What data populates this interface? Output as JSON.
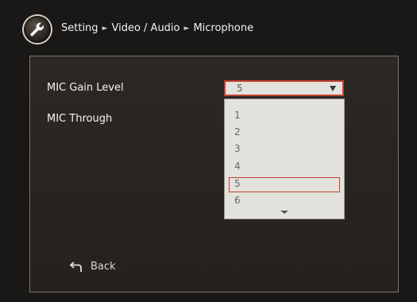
{
  "header": {
    "breadcrumb": [
      "Setting",
      "Video / Audio",
      "Microphone"
    ],
    "separator": "►"
  },
  "settings": {
    "mic_gain": {
      "label": "MIC Gain Level",
      "selected": "5",
      "options": [
        "1",
        "2",
        "3",
        "4",
        "5",
        "6"
      ]
    },
    "mic_through": {
      "label": "MIC Through"
    }
  },
  "footer": {
    "back_label": "Back"
  },
  "colors": {
    "accent": "#c2422f",
    "panel": "#2a2622",
    "dropdown": "#e4e2dc"
  },
  "icons": {
    "logo": "wrench-icon",
    "back": "return-arrow-icon",
    "select": "triangle-down-icon"
  }
}
